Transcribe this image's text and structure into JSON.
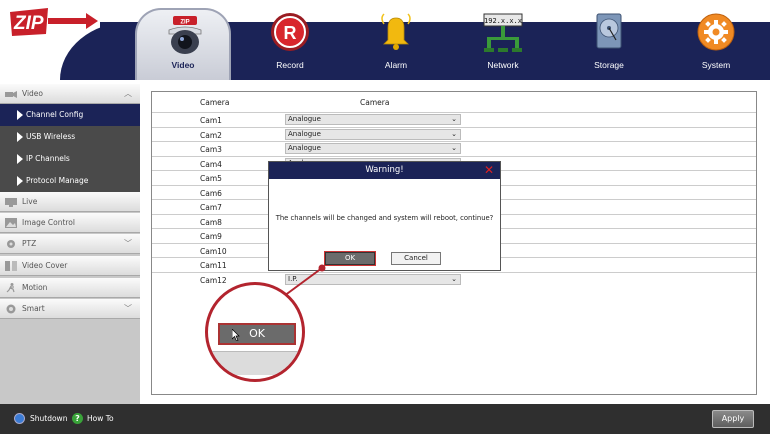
{
  "brand": {
    "logo_text": "ZIP"
  },
  "nav": {
    "video": "Video",
    "record": "Record",
    "alarm": "Alarm",
    "network": "Network",
    "network_badge": "192.x.x.x",
    "storage": "Storage",
    "system": "System"
  },
  "sidebar": {
    "video": "Video",
    "channel_config": "Channel Config",
    "usb_wireless": "USB Wireless",
    "ip_channels": "IP Channels",
    "protocol_manage": "Protocol Manage",
    "live": "Live",
    "image_control": "Image Control",
    "ptz": "PTZ",
    "video_cover": "Video Cover",
    "motion": "Motion",
    "smart": "Smart"
  },
  "table": {
    "headers": [
      "Camera",
      "Camera"
    ],
    "rows": [
      {
        "cam": "Cam1",
        "value": "Analogue"
      },
      {
        "cam": "Cam2",
        "value": "Analogue"
      },
      {
        "cam": "Cam3",
        "value": "Analogue"
      },
      {
        "cam": "Cam4",
        "value": "Analogue"
      },
      {
        "cam": "Cam5",
        "value": ""
      },
      {
        "cam": "Cam6",
        "value": ""
      },
      {
        "cam": "Cam7",
        "value": ""
      },
      {
        "cam": "Cam8",
        "value": ""
      },
      {
        "cam": "Cam9",
        "value": ""
      },
      {
        "cam": "Cam10",
        "value": ""
      },
      {
        "cam": "Cam11",
        "value": ""
      },
      {
        "cam": "Cam12",
        "value": "I.P."
      }
    ]
  },
  "dialog": {
    "title": "Warning!",
    "message": "The channels will be changed and system will reboot, continue?",
    "ok": "OK",
    "cancel": "Cancel",
    "magnified_ok": "OK"
  },
  "footer": {
    "shutdown": "Shutdown",
    "how_to": "How To",
    "apply": "Apply"
  },
  "colors": {
    "header_navy": "#1b2357",
    "accent_red": "#b3242e",
    "active_item": "#1b2357"
  }
}
